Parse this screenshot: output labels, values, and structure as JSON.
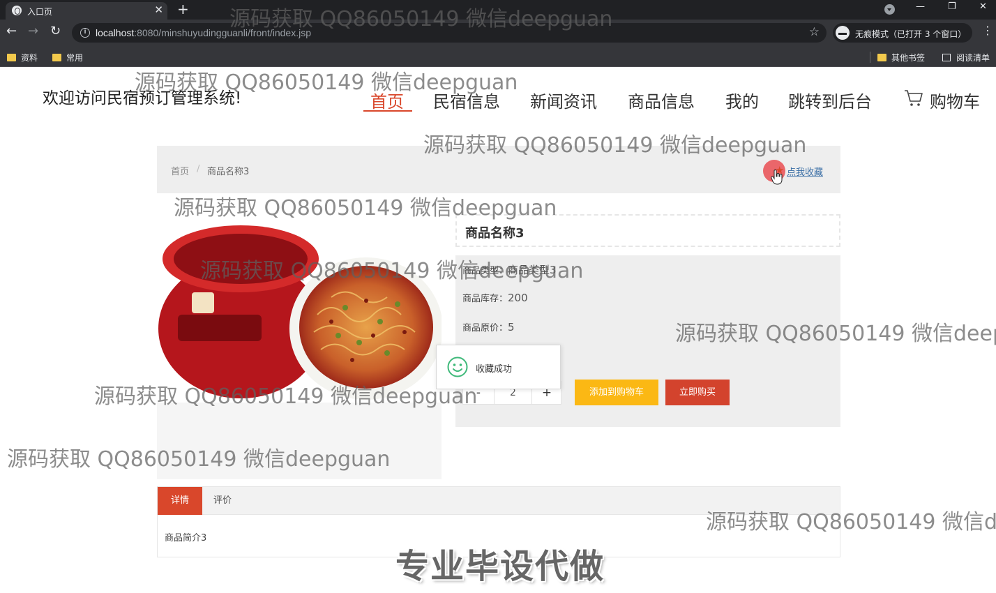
{
  "browser": {
    "tab_title": "入口页",
    "tab_close": "✕",
    "new_tab": "+",
    "url_host": "localhost",
    "url_path": ":8080/minshuyudingguanli/front/index.jsp",
    "incognito_label": "无痕模式（已打开 3 个窗口）",
    "bookmarks": [
      "资料",
      "常用"
    ],
    "other_bookmarks": "其他书签",
    "reading_list": "阅读清单",
    "win_min": "—",
    "win_restore": "❐",
    "win_close": "✕"
  },
  "site": {
    "welcome": "欢迎访问民宿预订管理系统!",
    "nav": [
      "首页",
      "民宿信息",
      "新闻资讯",
      "商品信息",
      "我的",
      "跳转到后台",
      "购物车"
    ]
  },
  "breadcrumb": {
    "home": "首页",
    "separator": "/",
    "current": "商品名称3",
    "favorite_link": "点我收藏"
  },
  "product": {
    "name": "商品名称3",
    "type_label": "商品类型：",
    "type_value": "商品类型3",
    "stock_label": "商品库存：",
    "stock_value": "200",
    "price_label": "商品原价：",
    "price_value": "5",
    "quantity": "2",
    "minus": "-",
    "plus": "+",
    "add_to_cart": "添加到购物车",
    "buy_now": "立即购买"
  },
  "toast": {
    "message": "收藏成功"
  },
  "tabs": {
    "detail": "详情",
    "review": "评价",
    "description": "商品简介3"
  },
  "watermark": {
    "text": "源码获取 QQ86050149 微信deepguan",
    "banner": "专业毕设代做"
  },
  "colors": {
    "accent": "#d9472b",
    "cart_button": "#fbb814",
    "buy_button": "#d3432d"
  }
}
